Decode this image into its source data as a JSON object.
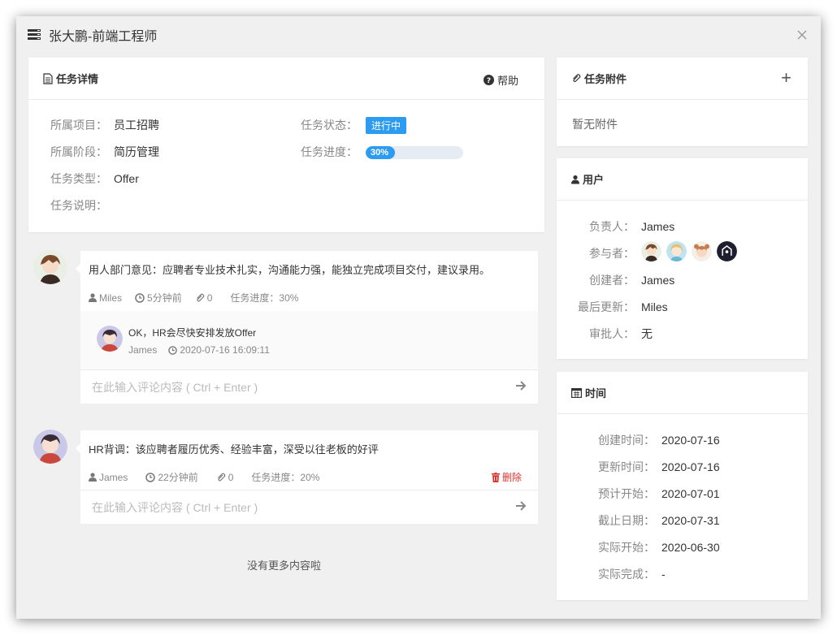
{
  "modal": {
    "title": "张大鹏-前端工程师",
    "title_icon": "list-icon",
    "close_icon": "close-icon"
  },
  "detail": {
    "title": "任务详情",
    "help_label": "帮助",
    "project_label": "所属项目：",
    "project_value": "员工招聘",
    "stage_label": "所属阶段：",
    "stage_value": "简历管理",
    "type_label": "任务类型：",
    "type_value": "Offer",
    "desc_label": "任务说明：",
    "status_label": "任务状态：",
    "status_value": "进行中",
    "progress_label": "任务进度：",
    "progress_text": "30%",
    "progress_value": 30,
    "accent": "#2d9cf0"
  },
  "comments": [
    {
      "text": "用人部门意见：应聘者专业技术扎实，沟通能力强，能独立完成项目交付，建议录用。",
      "author": "Miles",
      "time": "5分钟前",
      "attachments": "0",
      "progress": "任务进度：30%",
      "reply": {
        "text": "OK，HR会尽快安排发放Offer",
        "author": "James",
        "time": "2020-07-16 16:09:11"
      },
      "input_placeholder": "在此输入评论内容 ( Ctrl + Enter )"
    },
    {
      "text": "HR背调：该应聘者履历优秀、经验丰富，深受以往老板的好评",
      "author": "James",
      "time": "22分钟前",
      "attachments": "0",
      "progress": "任务进度：20%",
      "delete_label": "删除",
      "input_placeholder": "在此输入评论内容 ( Ctrl + Enter )"
    }
  ],
  "no_more": "没有更多内容啦",
  "attachments": {
    "title": "任务附件",
    "empty": "暂无附件",
    "add_icon": "+"
  },
  "users": {
    "title": "用户",
    "owner_label": "负责人：",
    "owner_value": "James",
    "participants_label": "参与者：",
    "creator_label": "创建者：",
    "creator_value": "James",
    "updated_label": "最后更新：",
    "updated_value": "Miles",
    "approver_label": "审批人：",
    "approver_value": "无"
  },
  "time": {
    "title": "时间",
    "created_label": "创建时间：",
    "created_value": "2020-07-16",
    "updated_label": "更新时间：",
    "updated_value": "2020-07-16",
    "plan_start_label": "预计开始：",
    "plan_start_value": "2020-07-01",
    "deadline_label": "截止日期：",
    "deadline_value": "2020-07-31",
    "actual_start_label": "实际开始：",
    "actual_start_value": "2020-06-30",
    "actual_end_label": "实际完成：",
    "actual_end_value": "-"
  }
}
